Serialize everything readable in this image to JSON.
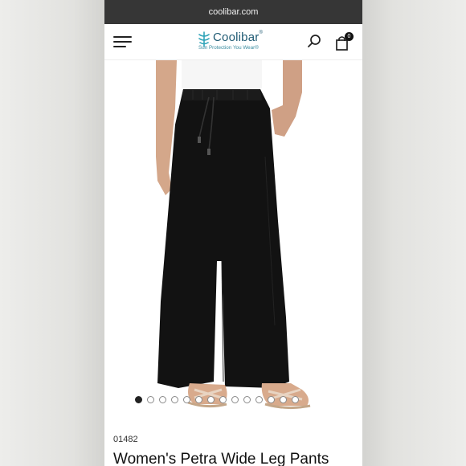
{
  "browser": {
    "url": "coolibar.com"
  },
  "header": {
    "menu_icon": "hamburger-menu-icon",
    "logo_name": "Coolibar",
    "logo_registered": "®",
    "logo_tagline": "Sun Protection You Wear®",
    "search_icon": "search-icon",
    "cart_icon": "shopping-bag-icon",
    "cart_count": "0"
  },
  "gallery": {
    "image_alt": "Women's Petra Wide Leg Pants product photo",
    "slide_count": 14,
    "active_slide": 1
  },
  "product": {
    "sku": "01482",
    "title": "Women's Petra Wide Leg Pants"
  },
  "colors": {
    "brand": "#1f5a73",
    "brand_light": "#3a8ca0",
    "url_bar": "#363636"
  }
}
